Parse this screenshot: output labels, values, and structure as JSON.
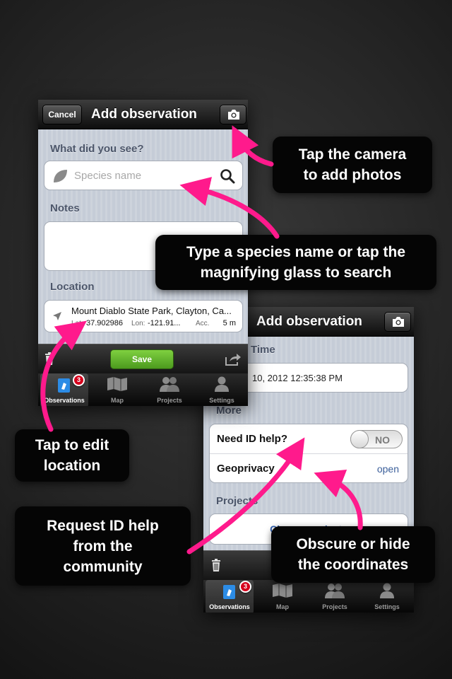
{
  "screen1": {
    "nav": {
      "cancel_label": "Cancel",
      "title": "Add observation"
    },
    "species_section_label": "What did you see?",
    "species_placeholder": "Species name",
    "notes_label": "Notes",
    "location_label": "Location",
    "location": {
      "place": "Mount Diablo State Park, Clayton, Ca...",
      "lat_label": "Lat:",
      "lat": "37.902986",
      "lon_label": "Lon:",
      "lon": "-121.91...",
      "acc_label": "Acc.",
      "acc": "5 m"
    },
    "toolbar": {
      "save_label": "Save"
    }
  },
  "screen2": {
    "nav": {
      "title": "Add observation"
    },
    "time_label": "Time",
    "time_value": "10, 2012 12:35:38 PM",
    "more_label": "More",
    "id_help_label": "Need ID help?",
    "id_help_toggle": "NO",
    "geoprivacy_label": "Geoprivacy",
    "geoprivacy_value": "open",
    "projects_label": "Projects",
    "choose_projects": "Choose projects"
  },
  "tabbar": {
    "items": [
      {
        "label": "Observations",
        "icon": "observations-icon"
      },
      {
        "label": "Map",
        "icon": "map-icon"
      },
      {
        "label": "Projects",
        "icon": "projects-icon"
      },
      {
        "label": "Settings",
        "icon": "settings-icon"
      }
    ],
    "badge": "3"
  },
  "callouts": {
    "camera": [
      "Tap the camera",
      "to add photos"
    ],
    "species": [
      "Type a species name or tap the",
      "magnifying glass to search"
    ],
    "location": [
      "Tap to edit",
      "location"
    ],
    "id_help": [
      "Request ID help",
      "from the",
      "community"
    ],
    "geoprivacy": [
      "Obscure or hide",
      "the coordinates"
    ]
  },
  "colors": {
    "accent_pink": "#ff1a8c",
    "save_green": "#62b52a",
    "link_blue": "#2f5fb0"
  }
}
